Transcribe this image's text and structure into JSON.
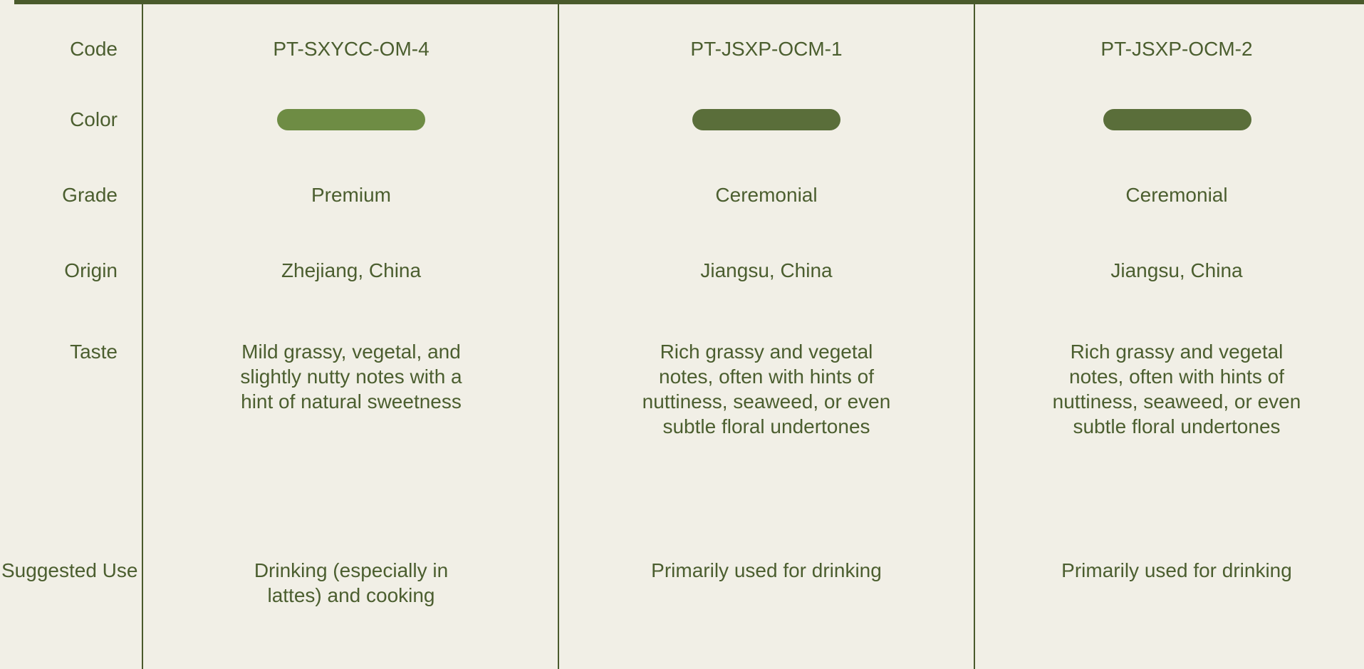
{
  "row_labels": {
    "code": "Code",
    "color": "Color",
    "grade": "Grade",
    "origin": "Origin",
    "taste": "Taste",
    "suggested_use": "Suggested Use"
  },
  "products": [
    {
      "code": "PT-SXYCC-OM-4",
      "color_hex": "#6e8c44",
      "grade": "Premium",
      "origin": "Zhejiang, China",
      "taste": "Mild grassy, vegetal, and slightly nutty notes with a hint of natural sweetness",
      "suggested_use": "Drinking (especially in lattes) and cooking"
    },
    {
      "code": "PT-JSXP-OCM-1",
      "color_hex": "#5a6e3a",
      "grade": "Ceremonial",
      "origin": "Jiangsu, China",
      "taste": "Rich grassy and vegetal notes, often with hints of nuttiness, seaweed, or even subtle floral undertones",
      "suggested_use": "Primarily used for drinking"
    },
    {
      "code": "PT-JSXP-OCM-2",
      "color_hex": "#5a6e3a",
      "grade": "Ceremonial",
      "origin": "Jiangsu, China",
      "taste": "Rich grassy and vegetal notes, often with hints of nuttiness, seaweed, or even subtle floral undertones",
      "suggested_use": "Primarily used for drinking"
    }
  ]
}
